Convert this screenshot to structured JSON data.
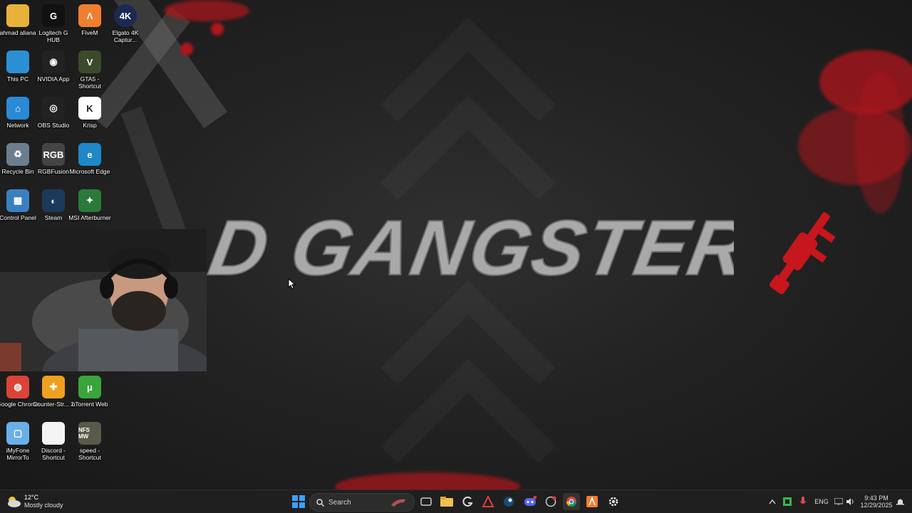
{
  "desktop": {
    "wallpaper_title": "OLD GANGSTER'S",
    "icons": [
      {
        "label": "ahmad aliana",
        "icon": "folder-icon"
      },
      {
        "label": "Logitech G HUB",
        "icon": "logitech-icon"
      },
      {
        "label": "FiveM",
        "icon": "fivem-icon"
      },
      {
        "label": "Elgato 4K Captur...",
        "icon": "elgato-icon"
      },
      {
        "label": "This PC",
        "icon": "monitor-icon"
      },
      {
        "label": "NVIDIA App",
        "icon": "nvidia-icon"
      },
      {
        "label": "GTA5 - Shortcut",
        "icon": "gta-icon"
      },
      {
        "label": "Network",
        "icon": "network-icon"
      },
      {
        "label": "OBS Studio",
        "icon": "obs-icon"
      },
      {
        "label": "Krisp",
        "icon": "krisp-icon"
      },
      {
        "label": "Recycle Bin",
        "icon": "recycle-bin-icon"
      },
      {
        "label": "RGBFusion",
        "icon": "rgb-icon"
      },
      {
        "label": "Microsoft Edge",
        "icon": "edge-icon"
      },
      {
        "label": "Control Panel",
        "icon": "control-panel-icon"
      },
      {
        "label": "Steam",
        "icon": "steam-icon"
      },
      {
        "label": "MSI Afterburner",
        "icon": "msi-icon"
      },
      {
        "label": "Google Chrome",
        "icon": "chrome-icon"
      },
      {
        "label": "Counter-Str... 2",
        "icon": "cs2-icon"
      },
      {
        "label": "uTorrent Web",
        "icon": "utorrent-icon"
      },
      {
        "label": "iMyFone MirrorTo",
        "icon": "imyfone-icon"
      },
      {
        "label": "Discord - Shortcut",
        "icon": "file-icon"
      },
      {
        "label": "speed - Shortcut",
        "icon": "nfs-icon"
      }
    ],
    "icon_glyphs": {
      "elgato": "4K",
      "rgb": "RGB",
      "gta": "V",
      "krisp": "K",
      "nfs": "NFS MW"
    }
  },
  "taskbar": {
    "weather_temp": "12°C",
    "weather_desc": "Mostly cloudy",
    "search_placeholder": "Search",
    "language": "ENG",
    "time": "9:43 PM",
    "date": "12/29/2025",
    "apps": [
      "start-icon",
      "task-view-icon",
      "file-explorer-icon",
      "g-hub-icon",
      "arrow-app-icon",
      "steam-icon",
      "discord-icon",
      "app-icon",
      "chrome-icon",
      "fivem-icon",
      "settings-icon"
    ]
  },
  "colors": {
    "accent_red": "#b0161c",
    "taskbar_bg": "#1f1f1f",
    "windows_blue": "#1e90ff"
  }
}
